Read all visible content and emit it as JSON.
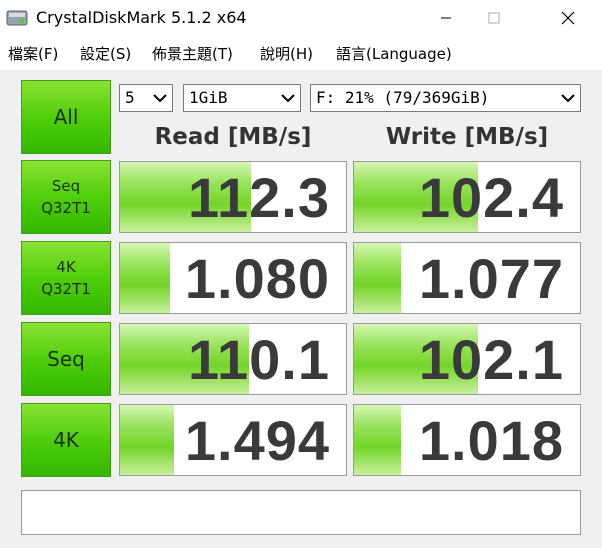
{
  "window": {
    "title": "CrystalDiskMark 5.1.2 x64"
  },
  "menu": [
    {
      "label": "檔案(F)"
    },
    {
      "label": "設定(S)"
    },
    {
      "label": "佈景主題(T)"
    },
    {
      "label": "說明(H)"
    },
    {
      "label": "語言(Language)"
    }
  ],
  "controls": {
    "all_label": "All",
    "count": "5",
    "size": "1GiB",
    "drive": "F: 21% (79/369GiB)"
  },
  "headers": {
    "read": "Read [MB/s]",
    "write": "Write [MB/s]"
  },
  "tests": [
    {
      "label_line1": "Seq",
      "label_line2": "Q32T1",
      "read": "112.3",
      "write": "102.4",
      "read_fill": 0.58,
      "write_fill": 0.55
    },
    {
      "label_line1": "4K",
      "label_line2": "Q32T1",
      "read": "1.080",
      "write": "1.077",
      "read_fill": 0.22,
      "write_fill": 0.21
    },
    {
      "label_line1": "Seq",
      "label_line2": "",
      "read": "110.1",
      "write": "102.1",
      "read_fill": 0.57,
      "write_fill": 0.55
    },
    {
      "label_line1": "4K",
      "label_line2": "",
      "read": "1.494",
      "write": "1.018",
      "read_fill": 0.24,
      "write_fill": 0.21
    }
  ],
  "status_text": "",
  "colors": {
    "accent_green": "#4fcf0a",
    "value_text": "#3a3a3a"
  }
}
